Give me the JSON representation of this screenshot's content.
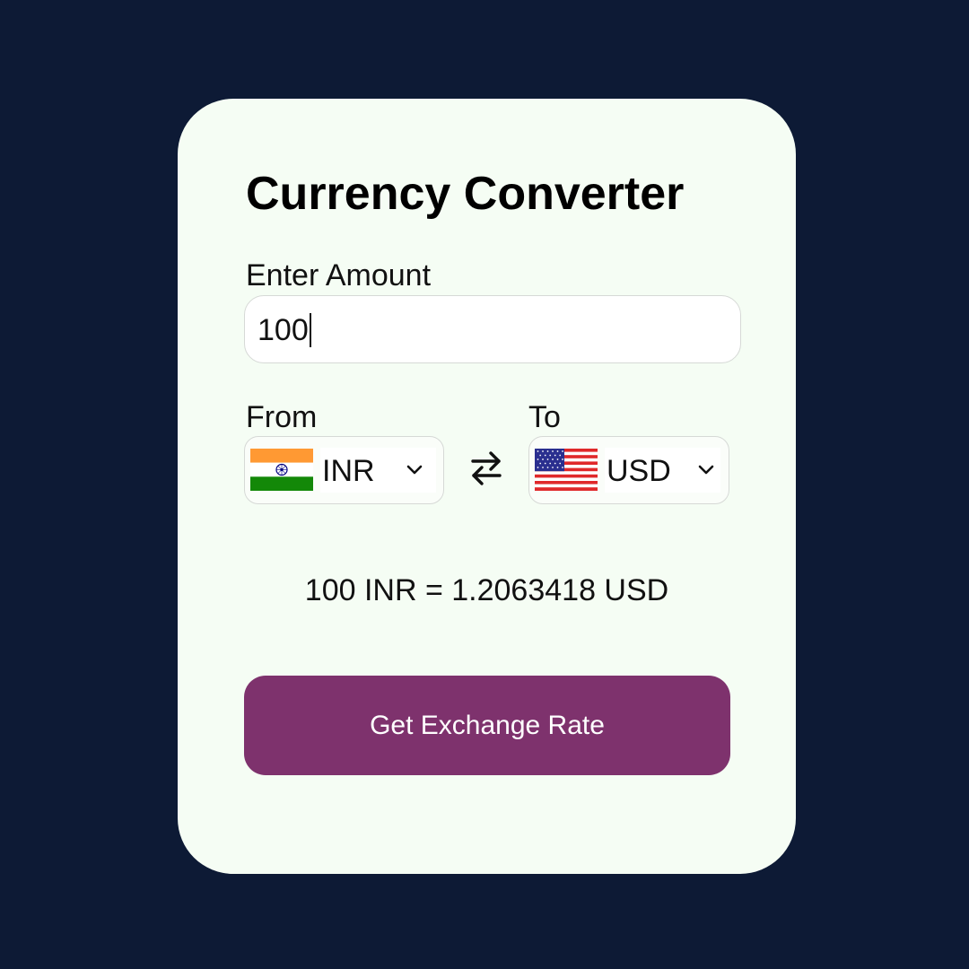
{
  "title": "Currency Converter",
  "amount": {
    "label": "Enter Amount",
    "value": "100"
  },
  "from": {
    "label": "From",
    "code": "INR",
    "flag": "india-flag-icon"
  },
  "to": {
    "label": "To",
    "code": "USD",
    "flag": "us-flag-icon"
  },
  "swap_icon": "swap-arrows-icon",
  "result": "100 INR = 1.2063418 USD",
  "button": {
    "label": "Get Exchange Rate"
  },
  "colors": {
    "background": "#0d1a35",
    "card": "#f5fdf4",
    "button": "#7e326d",
    "button_text": "#ffffff"
  }
}
